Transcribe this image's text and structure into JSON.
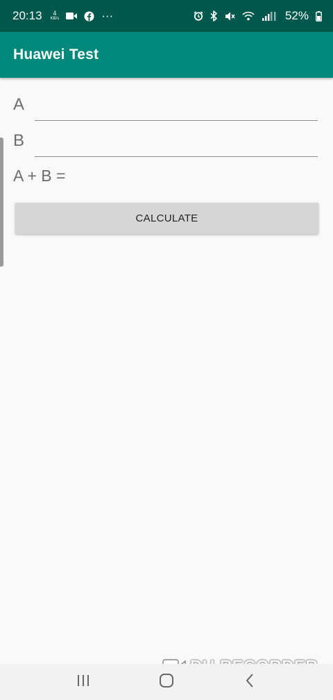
{
  "status_bar": {
    "time": "20:13",
    "data_rate": "4",
    "data_rate_unit": "KB/s",
    "more": "···",
    "battery": "52%"
  },
  "app_bar": {
    "title": "Huawei Test"
  },
  "form": {
    "label_a": "A",
    "value_a": "",
    "label_b": "B",
    "value_b": "",
    "result_label": "A + B ="
  },
  "actions": {
    "calculate_label": "CALCULATE"
  },
  "watermark": {
    "text": "DU RECORDER"
  },
  "colors": {
    "status_bar": "#00574b",
    "app_bar": "#00897b",
    "button": "#d6d6d6",
    "background": "#f8f9fb"
  },
  "icons": [
    "video-camera-icon",
    "facebook-icon",
    "alarm-icon",
    "bluetooth-icon",
    "mute-icon",
    "wifi-icon",
    "signal-icon",
    "battery-icon",
    "recent-apps-icon",
    "home-icon",
    "back-icon",
    "du-recorder-icon"
  ]
}
